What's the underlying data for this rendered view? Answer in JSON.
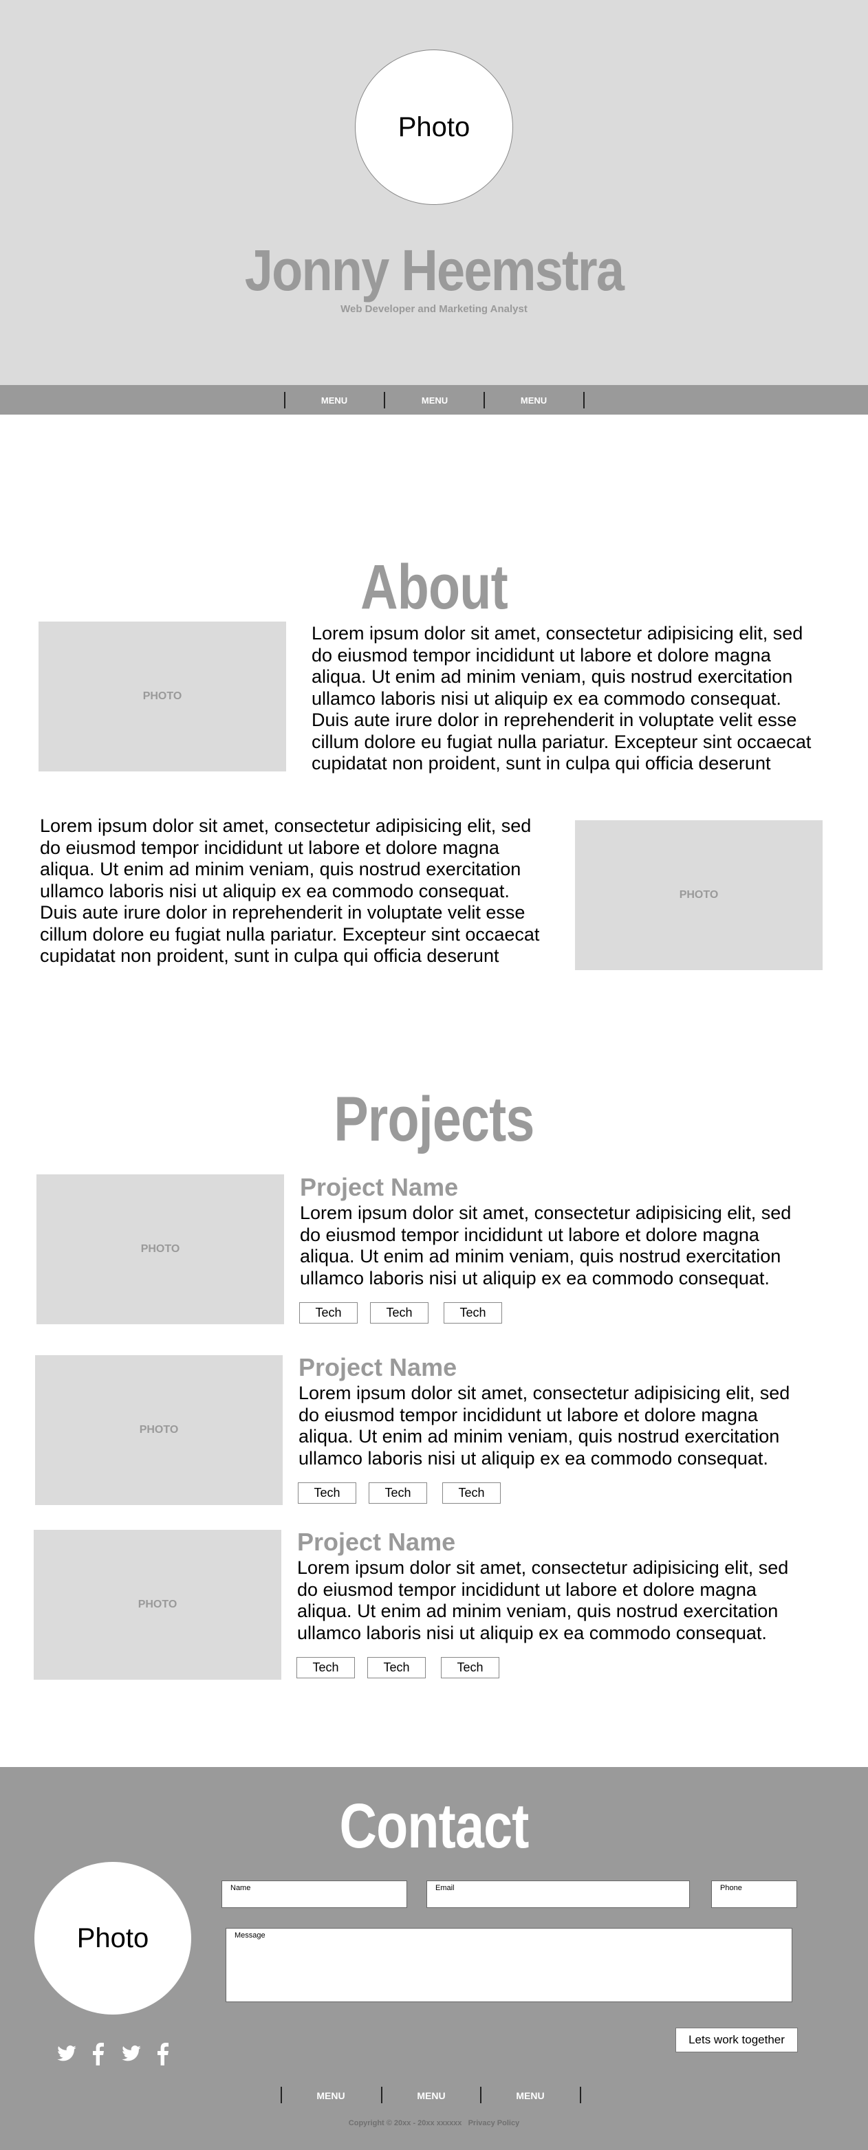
{
  "hero": {
    "photo_label": "Photo",
    "name": "Jonny Heemstra",
    "subtitle": "Web Developer and Marketing Analyst"
  },
  "nav": {
    "items": [
      "MENU",
      "MENU",
      "MENU"
    ]
  },
  "about": {
    "title": "About",
    "photo_label": "PHOTO",
    "paragraph_1": [
      "Lorem ipsum dolor sit amet, consectetur adipisicing elit, sed",
      "do eiusmod tempor incididunt ut labore et dolore magna",
      "aliqua. Ut enim ad minim veniam, quis nostrud exercitation",
      "ullamco laboris nisi ut aliquip ex ea commodo consequat.",
      "Duis aute irure dolor in reprehenderit in voluptate velit esse",
      "cillum dolore eu fugiat nulla pariatur. Excepteur sint occaecat",
      "cupidatat non proident, sunt in culpa qui officia deserunt"
    ],
    "paragraph_2": [
      "Lorem ipsum dolor sit amet, consectetur adipisicing elit, sed",
      "do eiusmod tempor incididunt ut labore et dolore magna",
      "aliqua. Ut enim ad minim veniam, quis nostrud exercitation",
      "ullamco laboris nisi ut aliquip ex ea commodo consequat.",
      "Duis aute irure dolor in reprehenderit in voluptate velit esse",
      "cillum dolore eu fugiat nulla pariatur. Excepteur sint occaecat",
      "cupidatat non proident, sunt in culpa qui officia deserunt"
    ]
  },
  "projects": {
    "title": "Projects",
    "items": [
      {
        "photo_label": "PHOTO",
        "name": "Project Name",
        "description": [
          "Lorem ipsum dolor sit amet, consectetur adipisicing elit, sed",
          "do eiusmod tempor incididunt ut labore et dolore magna",
          "aliqua. Ut enim ad minim veniam, quis nostrud exercitation",
          "ullamco laboris nisi ut aliquip ex ea commodo consequat."
        ],
        "tags": [
          "Tech",
          "Tech",
          "Tech"
        ]
      },
      {
        "photo_label": "PHOTO",
        "name": "Project Name",
        "description": [
          "Lorem ipsum dolor sit amet, consectetur adipisicing elit, sed",
          "do eiusmod tempor incididunt ut labore et dolore magna",
          "aliqua. Ut enim ad minim veniam, quis nostrud exercitation",
          "ullamco laboris nisi ut aliquip ex ea commodo consequat."
        ],
        "tags": [
          "Tech",
          "Tech",
          "Tech"
        ]
      },
      {
        "photo_label": "PHOTO",
        "name": "Project Name",
        "description": [
          "Lorem ipsum dolor sit amet, consectetur adipisicing elit, sed",
          "do eiusmod tempor incididunt ut labore et dolore magna",
          "aliqua. Ut enim ad minim veniam, quis nostrud exercitation",
          "ullamco laboris nisi ut aliquip ex ea commodo consequat."
        ],
        "tags": [
          "Tech",
          "Tech",
          "Tech"
        ]
      }
    ]
  },
  "contact": {
    "title": "Contact",
    "photo_label": "Photo",
    "fields": {
      "name": "Name",
      "email": "Email",
      "phone": "Phone",
      "message": "Message"
    },
    "cta_label": "Lets work together",
    "social_icons": [
      "twitter-icon",
      "facebook-icon",
      "twitter-icon",
      "facebook-icon"
    ]
  },
  "footer": {
    "nav_items": [
      "MENU",
      "MENU",
      "MENU"
    ],
    "copyright": "Copyright © 20xx - 20xx xxxxxx   Privacy Policy"
  },
  "colors": {
    "gray_light": "#dbdbdb",
    "gray_dark": "#9a9a9a",
    "white": "#ffffff"
  }
}
